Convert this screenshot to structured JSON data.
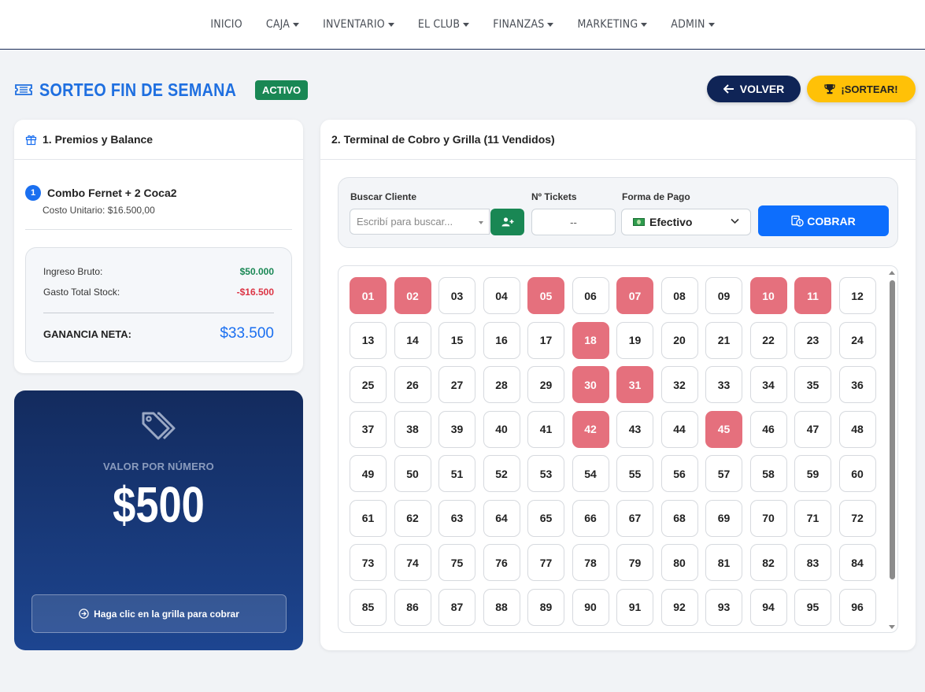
{
  "nav": {
    "items": [
      {
        "label": "INICIO",
        "dropdown": false
      },
      {
        "label": "CAJA",
        "dropdown": true
      },
      {
        "label": "INVENTARIO",
        "dropdown": true
      },
      {
        "label": "EL CLUB",
        "dropdown": true
      },
      {
        "label": "FINANZAS",
        "dropdown": true
      },
      {
        "label": "MARKETING",
        "dropdown": true
      },
      {
        "label": "ADMIN",
        "dropdown": true
      }
    ]
  },
  "header": {
    "icon": "ticket-icon",
    "title": "SORTEO FIN DE SEMANA",
    "status": "ACTIVO",
    "back_label": "VOLVER",
    "draw_label": "¡SORTEAR!"
  },
  "prizes": {
    "title": "1. Premios y Balance",
    "items": [
      {
        "number": "1",
        "name": "Combo Fernet + 2 Coca2",
        "cost": "Costo Unitario: $16.500,00"
      }
    ],
    "balance": {
      "gross_label": "Ingreso Bruto:",
      "gross_value": "$50.000",
      "stock_label": "Gasto Total Stock:",
      "stock_value": "-$16.500",
      "net_label": "GANANCIA NETA:",
      "net_value": "$33.500"
    }
  },
  "value_card": {
    "label": "VALOR POR NÚMERO",
    "price": "$500",
    "hint": "Haga clic en la grilla para cobrar"
  },
  "terminal": {
    "title": "2. Terminal de Cobro y Grilla (11 Vendidos)",
    "client_label": "Buscar Cliente",
    "client_placeholder": "Escribí para buscar...",
    "tickets_label": "Nº Tickets",
    "tickets_value": "--",
    "payment_label": "Forma de Pago",
    "payment_value": "Efectivo",
    "charge_label": "COBRAR",
    "sold_numbers": [
      "01",
      "02",
      "05",
      "07",
      "10",
      "11",
      "18",
      "30",
      "31",
      "42",
      "45"
    ],
    "grid_numbers": [
      "01",
      "02",
      "03",
      "04",
      "05",
      "06",
      "07",
      "08",
      "09",
      "10",
      "11",
      "12",
      "13",
      "14",
      "15",
      "16",
      "17",
      "18",
      "19",
      "20",
      "21",
      "22",
      "23",
      "24",
      "25",
      "26",
      "27",
      "28",
      "29",
      "30",
      "31",
      "32",
      "33",
      "34",
      "35",
      "36",
      "37",
      "38",
      "39",
      "40",
      "41",
      "42",
      "43",
      "44",
      "45",
      "46",
      "47",
      "48",
      "49",
      "50",
      "51",
      "52",
      "53",
      "54",
      "55",
      "56",
      "57",
      "58",
      "59",
      "60",
      "61",
      "62",
      "63",
      "64",
      "65",
      "66",
      "67",
      "68",
      "69",
      "70",
      "71",
      "72",
      "73",
      "74",
      "75",
      "76",
      "77",
      "78",
      "79",
      "80",
      "81",
      "82",
      "83",
      "84",
      "85",
      "86",
      "87",
      "88",
      "89",
      "90",
      "91",
      "92",
      "93",
      "94",
      "95",
      "96"
    ]
  },
  "colors": {
    "accent": "#1f6fe0",
    "sold": "#e5707d",
    "success": "#198754",
    "warning": "#ffc107",
    "navy": "#0f2456"
  }
}
